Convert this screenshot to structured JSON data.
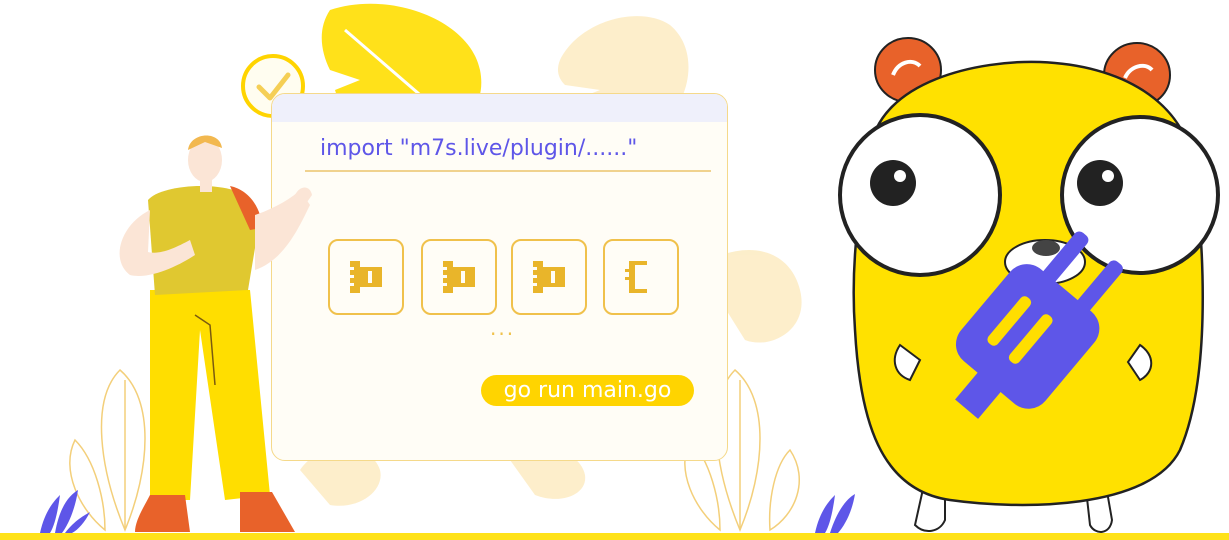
{
  "code_panel": {
    "import_statement": "import \"m7s.live/plugin/......\"",
    "ellipsis": "...",
    "run_button_label": "go run main.go"
  },
  "colors": {
    "accent_yellow": "#ffd400",
    "accent_purple": "#5e56e8",
    "outline_gold": "#f0c14b",
    "orange": "#e8622a"
  },
  "icons": [
    "check-circle-icon",
    "plugin-module-icon",
    "plug-icon",
    "gopher-mascot",
    "monstera-leaf",
    "person-illustration"
  ]
}
